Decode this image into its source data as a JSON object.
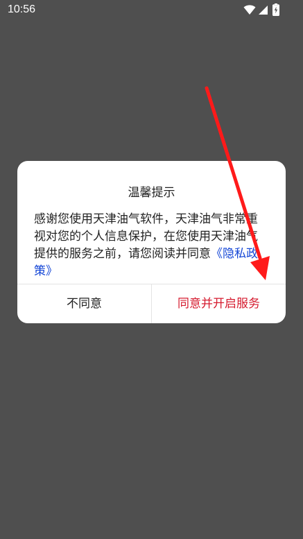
{
  "status_bar": {
    "time": "10:56",
    "icons": [
      "wifi-icon",
      "signal-icon",
      "battery-charging-icon"
    ]
  },
  "dialog": {
    "title": "温馨提示",
    "body_text": "感谢您使用天津油气软件，天津油气非常重视对您的个人信息保护，在您使用天津油气提供的服务之前，请您阅读并同意",
    "policy_link": "《隐私政策》",
    "disagree_label": "不同意",
    "agree_label": "同意并开启服务"
  },
  "colors": {
    "backdrop": "#4f4f4f",
    "link": "#1446d6",
    "agree": "#d51a2e",
    "annotation_arrow": "#ff1a1a"
  }
}
